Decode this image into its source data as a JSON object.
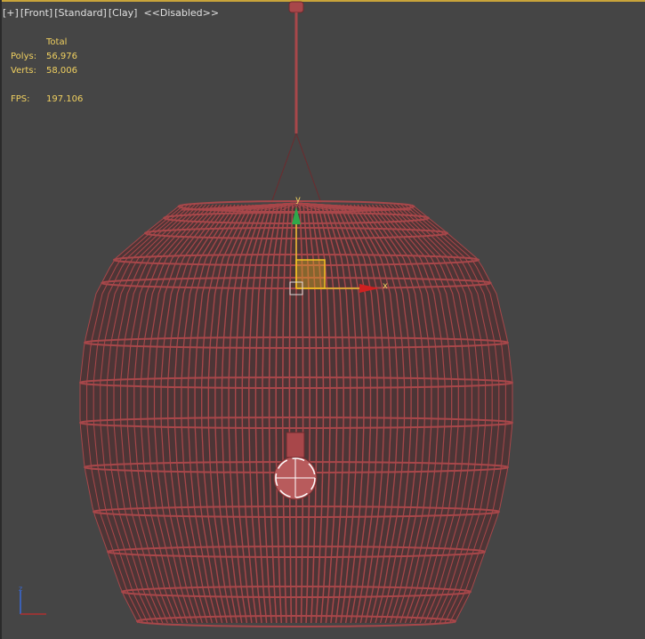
{
  "viewport": {
    "label_tokens": [
      "[+]",
      "[Front]",
      "[Standard]",
      "[Clay]",
      "<<Disabled>>"
    ]
  },
  "stats": {
    "header": "Total",
    "rows": [
      {
        "key": "Polys:",
        "value": "56,976"
      },
      {
        "key": "Verts:",
        "value": "58,006"
      }
    ],
    "fps_key": "FPS:",
    "fps_value": "197.106"
  },
  "gizmo": {
    "y_label": "y",
    "x_label": "x"
  },
  "colors": {
    "background": "#454545",
    "mesh": "#a8474a",
    "mesh_dark": "#6e2a2d",
    "stats_text": "#f0d060",
    "active_border": "#c8a43a",
    "axis_y": "#2fa84a",
    "axis_x": "#d02020",
    "gizmo_plane": "#f0c020"
  }
}
